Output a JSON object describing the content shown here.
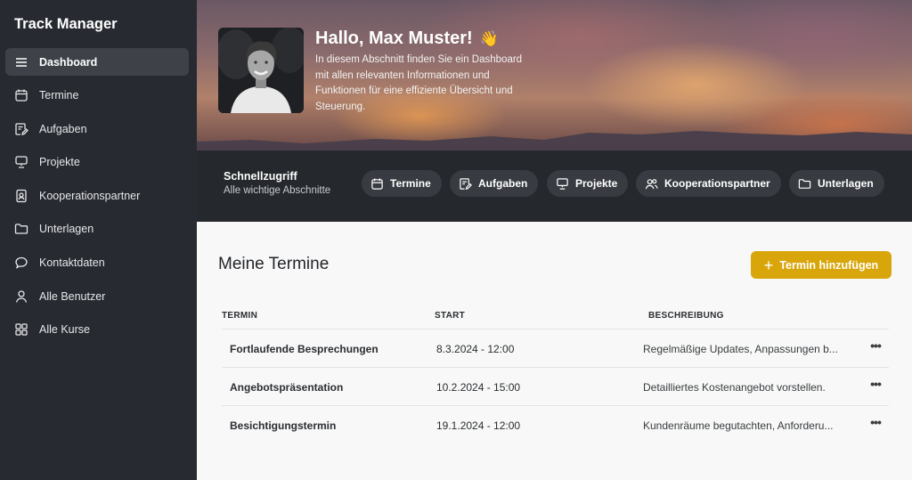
{
  "app": {
    "title": "Track Manager"
  },
  "sidebar": {
    "items": [
      {
        "label": "Dashboard",
        "icon": "menu-icon",
        "active": true
      },
      {
        "label": "Termine",
        "icon": "calendar-icon"
      },
      {
        "label": "Aufgaben",
        "icon": "edit-note-icon"
      },
      {
        "label": "Projekte",
        "icon": "presentation-icon"
      },
      {
        "label": "Kooperationspartner",
        "icon": "contact-card-icon"
      },
      {
        "label": "Unterlagen",
        "icon": "folder-icon"
      },
      {
        "label": "Kontaktdaten",
        "icon": "chat-bubble-icon"
      },
      {
        "label": "Alle Benutzer",
        "icon": "user-icon"
      },
      {
        "label": "Alle Kurse",
        "icon": "grid-icon"
      }
    ]
  },
  "hero": {
    "greeting": "Hallo, Max Muster!",
    "wave": "👋",
    "description": "In diesem Abschnitt finden Sie ein Dashboard mit allen relevanten Informationen und Funktionen für eine effiziente Übersicht und Steuerung."
  },
  "quick_access": {
    "title": "Schnellzugriff",
    "subtitle": "Alle wichtige Abschnitte",
    "chips": [
      {
        "label": "Termine",
        "icon": "calendar-icon"
      },
      {
        "label": "Aufgaben",
        "icon": "edit-note-icon"
      },
      {
        "label": "Projekte",
        "icon": "presentation-icon"
      },
      {
        "label": "Kooperationspartner",
        "icon": "users-icon"
      },
      {
        "label": "Unterlagen",
        "icon": "folder-icon"
      }
    ]
  },
  "main": {
    "title": "Meine Termine",
    "add_button": "Termin hinzufügen",
    "columns": [
      "TERMIN",
      "START",
      "BESCHREIBUNG"
    ],
    "rows": [
      {
        "title": "Fortlaufende Besprechungen",
        "start": "8.3.2024 - 12:00",
        "description": "Regelmäßige Updates, Anpassungen b..."
      },
      {
        "title": "Angebotspräsentation",
        "start": "10.2.2024 - 15:00",
        "description": "Detailliertes Kostenangebot vorstellen."
      },
      {
        "title": "Besichtigungstermin",
        "start": "19.1.2024 - 12:00",
        "description": "Kundenräume begutachten, Anforderu..."
      }
    ],
    "row_menu": "•••"
  },
  "colors": {
    "accent": "#d8a60b",
    "sidebar": "#272a30",
    "active_item": "#3e4248"
  }
}
